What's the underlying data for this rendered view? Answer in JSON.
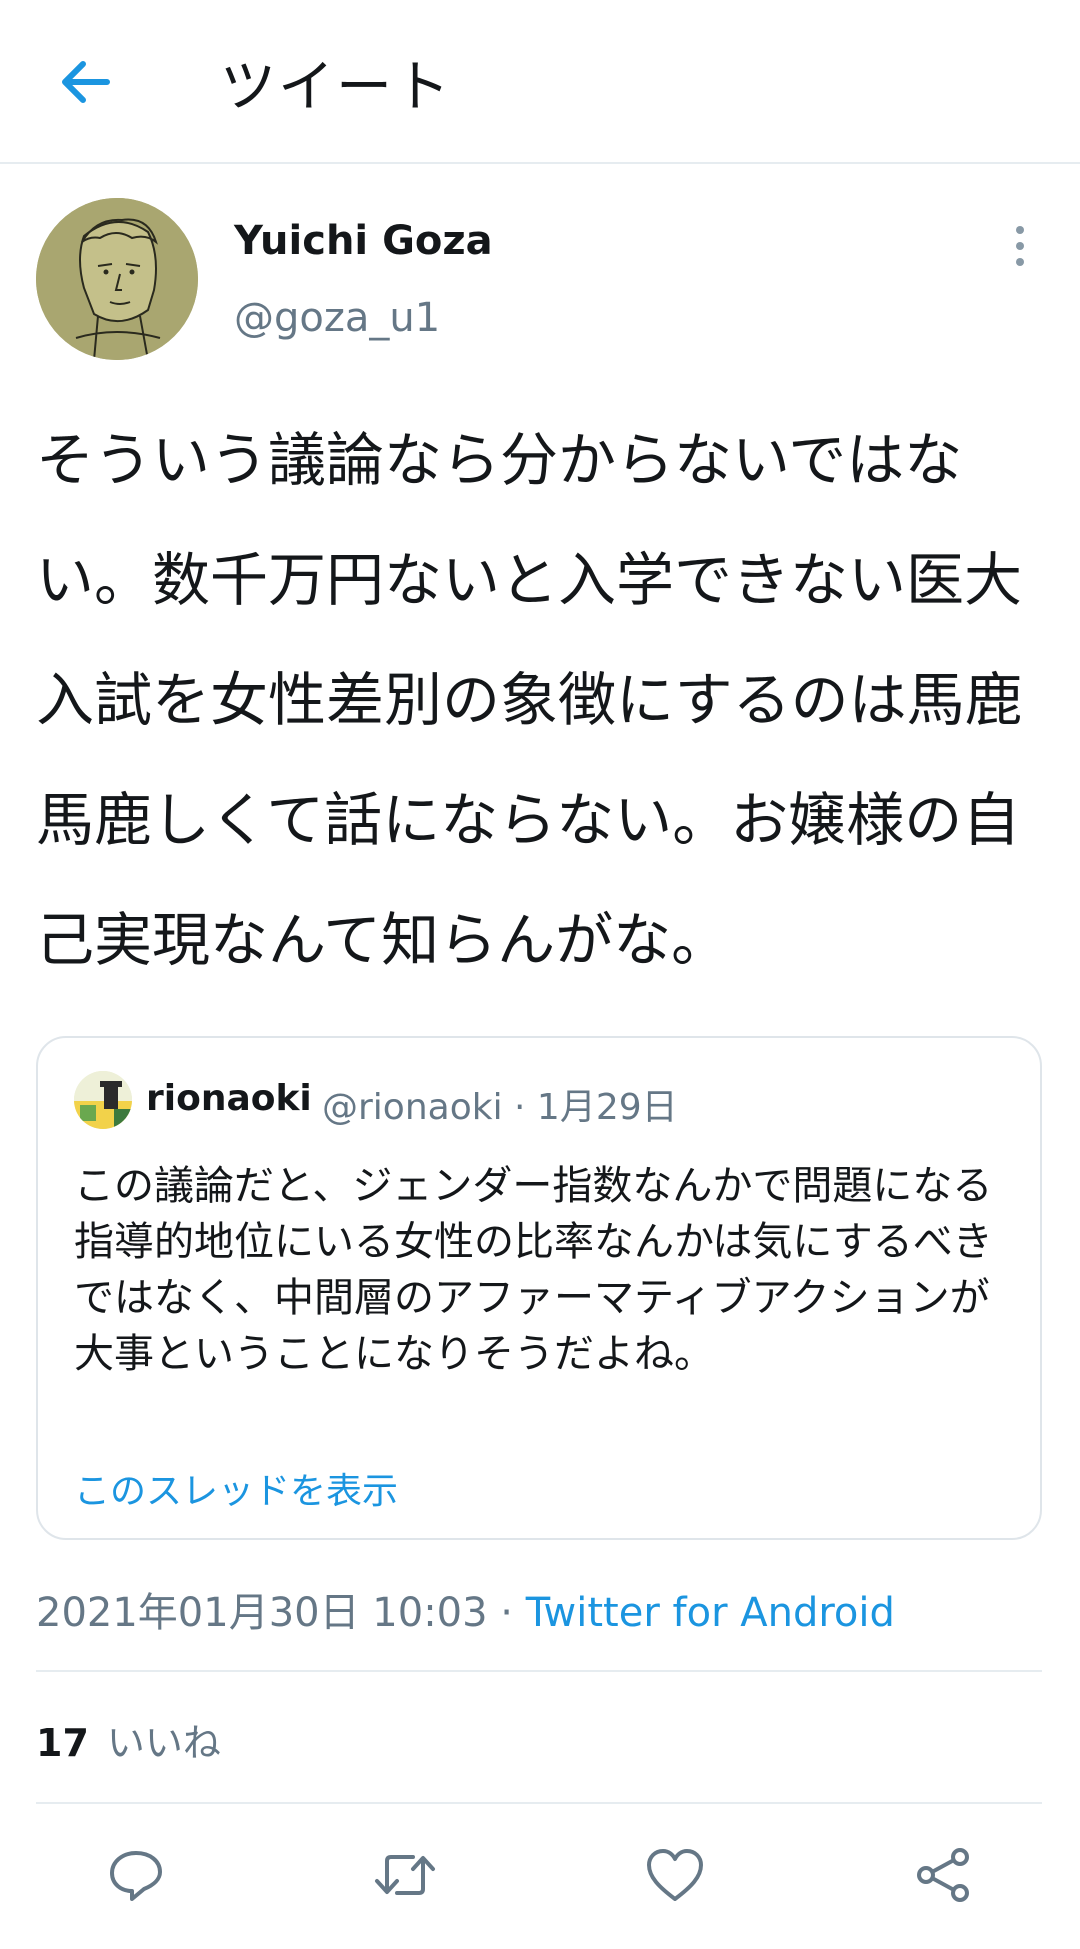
{
  "header": {
    "title": "ツイート",
    "back_icon": "arrow-left-icon"
  },
  "author": {
    "name": "Yuichi Goza",
    "handle": "@goza_u1"
  },
  "tweet": {
    "text": "そういう議論なら分からないではない。数千万円ないと入学できない医大入試を女性差別の象徴にするのは馬鹿馬鹿しくて話にならない。お嬢様の自己実現なんて知らんがな。"
  },
  "quote": {
    "name": "rionaoki",
    "handle": "@rionaoki · 1月29日",
    "text": "この議論だと、ジェンダー指数なんかで問題になる指導的地位にいる女性の比率なんかは気にするべきではなく、中間層のアファーマティブアクションが大事ということになりそうだよね。",
    "thread_link": "このスレッドを表示"
  },
  "meta": {
    "timestamp": "2021年01月30日 10:03 · ",
    "source": "Twitter for Android"
  },
  "stats": {
    "likes_count": "17",
    "likes_label": "いいね"
  },
  "colors": {
    "accent": "#1b95e0",
    "muted": "#657786",
    "divider": "#e6ecf0"
  },
  "actions": [
    "reply-icon",
    "retweet-icon",
    "like-icon",
    "share-icon"
  ]
}
